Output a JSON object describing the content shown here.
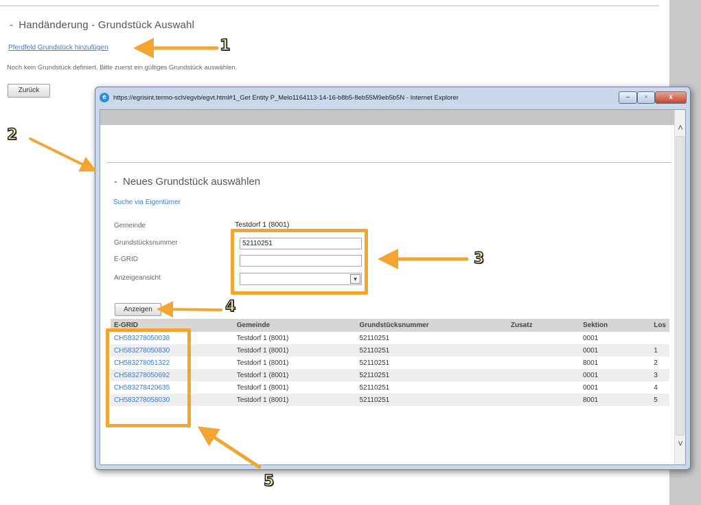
{
  "background_page": {
    "title": "Handänderung - Grundstück Auswahl",
    "prefix": "-",
    "link": "Pferdfeld Grundstück hinzufügen",
    "info_text": "Noch kein Grundstück definiert. Bitte zuerst ein gültiges Grundstück auswählen.",
    "back_button": "Zurück"
  },
  "popup": {
    "url_title": "https://egrisint.termo-sch/egvb/egvt.html#1_Get Entity P_Melo1164113-14-16-b8b5-8eb55M9eb5b5N - Internet Explorer",
    "window_buttons": {
      "minimize": "–",
      "maximize": "▫",
      "close": "x"
    },
    "section_title": "Neues Grundstück auswählen",
    "section_prefix": "-",
    "search_link": "Suche via Eigentümer",
    "form": {
      "gemeinde_label": "Gemeinde",
      "gemeinde_value": "Testdorf 1 (8001)",
      "grundstuecksnummer_label": "Grundstücksnummer",
      "grundstuecksnummer_value": "52110251",
      "egrid_label": "E-GRID",
      "egrid_value": "",
      "anzeigeansicht_label": "Anzeigeansicht",
      "anzeigeansicht_value": ""
    },
    "anzeigen_button": "Anzeigen",
    "table": {
      "headers": [
        "E-GRID",
        "Gemeinde",
        "Grundstücksnummer",
        "Zusatz",
        "Sektion",
        "Los"
      ],
      "rows": [
        [
          "CH583278050038",
          "Testdorf 1 (8001)",
          "52110251",
          "",
          "0001",
          ""
        ],
        [
          "CH583278050830",
          "Testdorf 1 (8001)",
          "52110251",
          "",
          "0001",
          "1"
        ],
        [
          "CH583278051322",
          "Testdorf 1 (8001)",
          "52110251",
          "",
          "8001",
          "2"
        ],
        [
          "CH583278050692",
          "Testdorf 1 (8001)",
          "52110251",
          "",
          "0001",
          "3"
        ],
        [
          "CH583278420635",
          "Testdorf 1 (8001)",
          "52110251",
          "",
          "0001",
          "4"
        ],
        [
          "CH583278058030",
          "Testdorf 1 (8001)",
          "52110251",
          "",
          "8001",
          "5"
        ]
      ]
    }
  },
  "annotations": {
    "color": "#f2a531",
    "numbers": [
      "1",
      "2",
      "3",
      "4",
      "5"
    ]
  }
}
